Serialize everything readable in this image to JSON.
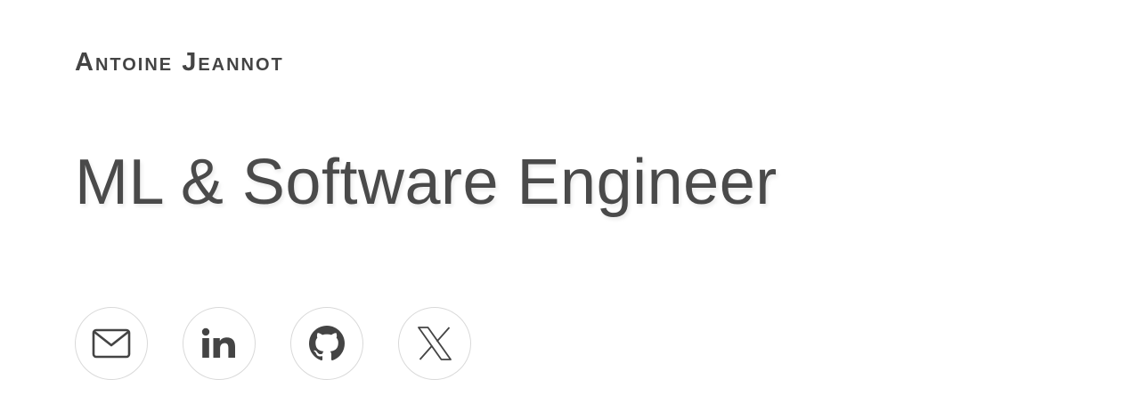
{
  "header": {
    "site_name": "Antoine Jeannot"
  },
  "hero": {
    "tagline": "ML & Software Engineer"
  },
  "social": {
    "links": [
      {
        "name": "email",
        "icon": "envelope-icon"
      },
      {
        "name": "linkedin",
        "icon": "linkedin-icon"
      },
      {
        "name": "github",
        "icon": "github-icon"
      },
      {
        "name": "x",
        "icon": "x-logo-icon"
      }
    ],
    "icon_color": "#444444",
    "border_color": "#d9d9d9"
  }
}
